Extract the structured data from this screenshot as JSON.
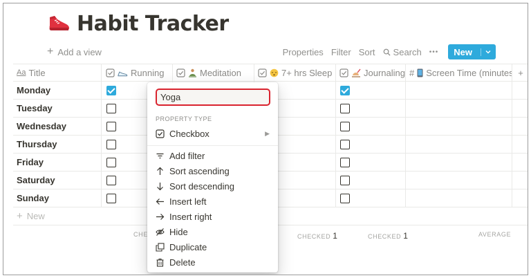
{
  "page": {
    "title": "Habit Tracker",
    "title_icon": "red-sneaker-icon"
  },
  "view_bar": {
    "add_view_label": "Add a view",
    "properties_label": "Properties",
    "filter_label": "Filter",
    "sort_label": "Sort",
    "search_label": "Search",
    "more_label": "•••",
    "new_label": "New"
  },
  "table": {
    "columns": [
      {
        "label": "Title",
        "icon": "title-aa-icon"
      },
      {
        "label": "Running",
        "icon": "shoe-icon"
      },
      {
        "label": "Meditation",
        "icon": "meditation-icon"
      },
      {
        "label": "7+ hrs Sleep",
        "icon": "sleep-face-icon"
      },
      {
        "label": "Journaling",
        "icon": "writing-hand-icon"
      },
      {
        "label": "Screen Time (minutes)",
        "icon": "mobile-phone-icon"
      }
    ],
    "rows": [
      {
        "title": "Monday",
        "running": true,
        "journaling": true
      },
      {
        "title": "Tuesday",
        "running": false,
        "journaling": false
      },
      {
        "title": "Wednesday",
        "running": false,
        "journaling": false
      },
      {
        "title": "Thursday",
        "running": false,
        "journaling": false
      },
      {
        "title": "Friday",
        "running": false,
        "journaling": false
      },
      {
        "title": "Saturday",
        "running": false,
        "journaling": false
      },
      {
        "title": "Sunday",
        "running": false,
        "journaling": false
      }
    ],
    "new_row_label": "New",
    "calc_partial_label": "CHEC",
    "calc_checked_label": "CHECKED",
    "calc_sleep_value": "1",
    "calc_journal_value": "1",
    "calc_average_label": "AVERAGE"
  },
  "property_menu": {
    "name_value": "Yoga",
    "section_label": "PROPERTY TYPE",
    "type_label": "Checkbox",
    "items": [
      {
        "label": "Add filter",
        "icon": "filter-lines-icon"
      },
      {
        "label": "Sort ascending",
        "icon": "arrow-up-icon"
      },
      {
        "label": "Sort descending",
        "icon": "arrow-down-icon"
      },
      {
        "label": "Insert left",
        "icon": "arrow-left-icon"
      },
      {
        "label": "Insert right",
        "icon": "arrow-right-icon"
      },
      {
        "label": "Hide",
        "icon": "eye-off-icon"
      },
      {
        "label": "Duplicate",
        "icon": "duplicate-icon"
      },
      {
        "label": "Delete",
        "icon": "trash-icon"
      }
    ]
  },
  "colors": {
    "accent": "#2eaadc",
    "focus_ring": "#d9232e"
  }
}
